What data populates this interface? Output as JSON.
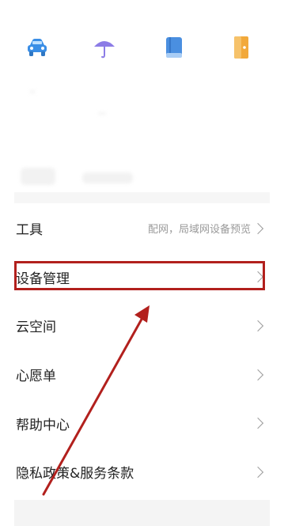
{
  "top_icons": [
    {
      "name": "car-icon",
      "color": "#3a8ee6"
    },
    {
      "name": "umbrella-icon",
      "color": "#8c7ce6"
    },
    {
      "name": "book-icon",
      "color": "#4a8fe0"
    },
    {
      "name": "door-icon",
      "color": "#f2a93b"
    }
  ],
  "menu": {
    "items": [
      {
        "label": "工具",
        "hint": "配网，局域网设备预览"
      },
      {
        "label": "设备管理",
        "hint": ""
      },
      {
        "label": "云空间",
        "hint": ""
      },
      {
        "label": "心愿单",
        "hint": ""
      },
      {
        "label": "帮助中心",
        "hint": ""
      },
      {
        "label": "隐私政策&服务条款",
        "hint": ""
      }
    ]
  },
  "annotation": {
    "highlight_color": "#b2201d",
    "highlighted_item": "设备管理"
  }
}
